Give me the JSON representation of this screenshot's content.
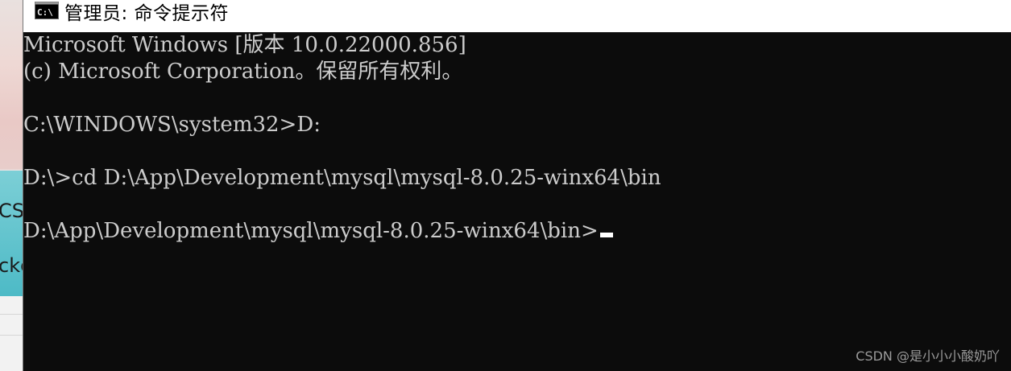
{
  "window": {
    "title": "管理员: 命令提示符",
    "title_icon": "cmd-icon"
  },
  "console": {
    "lines": [
      "Microsoft Windows [版本 10.0.22000.856]",
      "(c) Microsoft Corporation。保留所有权利。",
      "",
      "C:\\WINDOWS\\system32>D:",
      "",
      "D:\\>cd D:\\App\\Development\\mysql\\mysql-8.0.25-winx64\\bin",
      "",
      "D:\\App\\Development\\mysql\\mysql-8.0.25-winx64\\bin>"
    ],
    "text_color": "#cccccc",
    "background_color": "#0c0c0c"
  },
  "background_window": {
    "fragments": [
      "CSD",
      "ckc"
    ]
  },
  "watermark": "CSDN @是小小小酸奶吖"
}
